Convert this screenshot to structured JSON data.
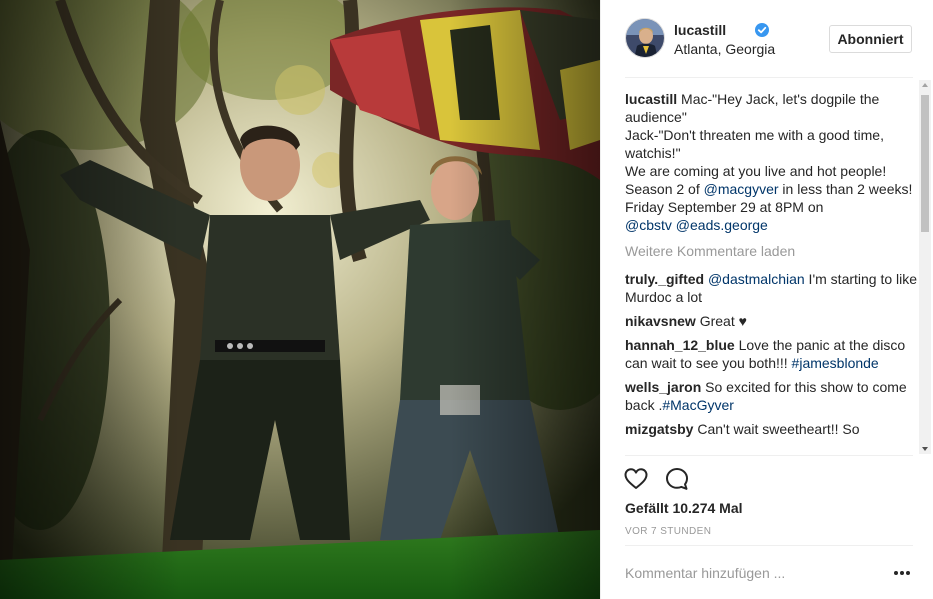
{
  "header": {
    "username": "lucastill",
    "location": "Atlanta, Georgia",
    "follow_label": "Abonniert"
  },
  "caption": {
    "user": "lucastill",
    "line1": "Mac-\"Hey Jack, let's dogpile the audience\"",
    "line2": "Jack-\"Don't threaten me with a good time, watchis!\"",
    "line3": "We are coming at you live and hot people! Season 2 of ",
    "mention1": "@macgyver",
    "line4": " in less than 2 weeks! Friday September 29 at 8PM on ",
    "mention2": "@cbstv",
    "mention3": "@eads.george"
  },
  "load_more": "Weitere Kommentare laden",
  "comments": [
    {
      "user": "truly._gifted",
      "mention": "@dastmalchian",
      "text": " I'm starting to like Murdoc a lot"
    },
    {
      "user": "nikavsnew",
      "text": "Great ♥"
    },
    {
      "user": "hannah_12_blue",
      "text": "Love the panic at the disco can wait to see you both!!! ",
      "tag": "#jamesblonde"
    },
    {
      "user": "wells_jaron",
      "text": "So excited for this show to come back .",
      "tag": "#MacGyver"
    },
    {
      "user": "mizgatsby",
      "text": "Can't wait sweetheart!! So"
    }
  ],
  "likes": "Gefällt 10.274 Mal",
  "timestamp": "VOR 7 STUNDEN",
  "comment_placeholder": "Kommentar hinzufügen ...",
  "icons": {
    "like": "heart-icon",
    "comment": "comment-bubble-icon",
    "more": "more-options-icon",
    "verified": "verified-badge-icon"
  },
  "colors": {
    "link": "#003569",
    "verified": "#3897f0",
    "muted": "#999999"
  }
}
